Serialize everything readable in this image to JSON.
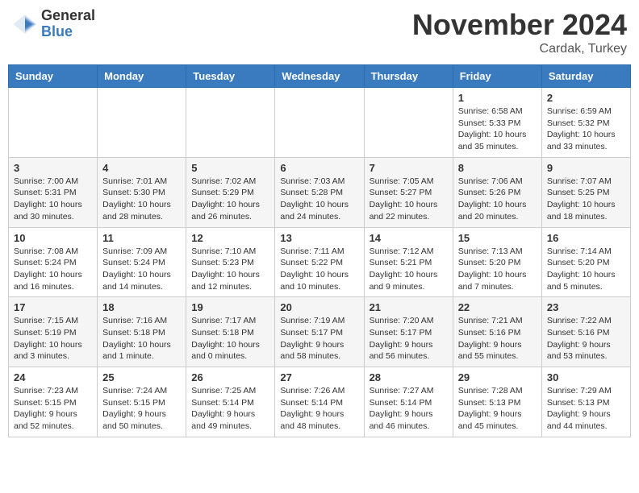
{
  "logo": {
    "general": "General",
    "blue": "Blue"
  },
  "header": {
    "month": "November 2024",
    "location": "Cardak, Turkey"
  },
  "weekdays": [
    "Sunday",
    "Monday",
    "Tuesday",
    "Wednesday",
    "Thursday",
    "Friday",
    "Saturday"
  ],
  "weeks": [
    [
      {
        "day": "",
        "info": ""
      },
      {
        "day": "",
        "info": ""
      },
      {
        "day": "",
        "info": ""
      },
      {
        "day": "",
        "info": ""
      },
      {
        "day": "",
        "info": ""
      },
      {
        "day": "1",
        "info": "Sunrise: 6:58 AM\nSunset: 5:33 PM\nDaylight: 10 hours and 35 minutes."
      },
      {
        "day": "2",
        "info": "Sunrise: 6:59 AM\nSunset: 5:32 PM\nDaylight: 10 hours and 33 minutes."
      }
    ],
    [
      {
        "day": "3",
        "info": "Sunrise: 7:00 AM\nSunset: 5:31 PM\nDaylight: 10 hours and 30 minutes."
      },
      {
        "day": "4",
        "info": "Sunrise: 7:01 AM\nSunset: 5:30 PM\nDaylight: 10 hours and 28 minutes."
      },
      {
        "day": "5",
        "info": "Sunrise: 7:02 AM\nSunset: 5:29 PM\nDaylight: 10 hours and 26 minutes."
      },
      {
        "day": "6",
        "info": "Sunrise: 7:03 AM\nSunset: 5:28 PM\nDaylight: 10 hours and 24 minutes."
      },
      {
        "day": "7",
        "info": "Sunrise: 7:05 AM\nSunset: 5:27 PM\nDaylight: 10 hours and 22 minutes."
      },
      {
        "day": "8",
        "info": "Sunrise: 7:06 AM\nSunset: 5:26 PM\nDaylight: 10 hours and 20 minutes."
      },
      {
        "day": "9",
        "info": "Sunrise: 7:07 AM\nSunset: 5:25 PM\nDaylight: 10 hours and 18 minutes."
      }
    ],
    [
      {
        "day": "10",
        "info": "Sunrise: 7:08 AM\nSunset: 5:24 PM\nDaylight: 10 hours and 16 minutes."
      },
      {
        "day": "11",
        "info": "Sunrise: 7:09 AM\nSunset: 5:24 PM\nDaylight: 10 hours and 14 minutes."
      },
      {
        "day": "12",
        "info": "Sunrise: 7:10 AM\nSunset: 5:23 PM\nDaylight: 10 hours and 12 minutes."
      },
      {
        "day": "13",
        "info": "Sunrise: 7:11 AM\nSunset: 5:22 PM\nDaylight: 10 hours and 10 minutes."
      },
      {
        "day": "14",
        "info": "Sunrise: 7:12 AM\nSunset: 5:21 PM\nDaylight: 10 hours and 9 minutes."
      },
      {
        "day": "15",
        "info": "Sunrise: 7:13 AM\nSunset: 5:20 PM\nDaylight: 10 hours and 7 minutes."
      },
      {
        "day": "16",
        "info": "Sunrise: 7:14 AM\nSunset: 5:20 PM\nDaylight: 10 hours and 5 minutes."
      }
    ],
    [
      {
        "day": "17",
        "info": "Sunrise: 7:15 AM\nSunset: 5:19 PM\nDaylight: 10 hours and 3 minutes."
      },
      {
        "day": "18",
        "info": "Sunrise: 7:16 AM\nSunset: 5:18 PM\nDaylight: 10 hours and 1 minute."
      },
      {
        "day": "19",
        "info": "Sunrise: 7:17 AM\nSunset: 5:18 PM\nDaylight: 10 hours and 0 minutes."
      },
      {
        "day": "20",
        "info": "Sunrise: 7:19 AM\nSunset: 5:17 PM\nDaylight: 9 hours and 58 minutes."
      },
      {
        "day": "21",
        "info": "Sunrise: 7:20 AM\nSunset: 5:17 PM\nDaylight: 9 hours and 56 minutes."
      },
      {
        "day": "22",
        "info": "Sunrise: 7:21 AM\nSunset: 5:16 PM\nDaylight: 9 hours and 55 minutes."
      },
      {
        "day": "23",
        "info": "Sunrise: 7:22 AM\nSunset: 5:16 PM\nDaylight: 9 hours and 53 minutes."
      }
    ],
    [
      {
        "day": "24",
        "info": "Sunrise: 7:23 AM\nSunset: 5:15 PM\nDaylight: 9 hours and 52 minutes."
      },
      {
        "day": "25",
        "info": "Sunrise: 7:24 AM\nSunset: 5:15 PM\nDaylight: 9 hours and 50 minutes."
      },
      {
        "day": "26",
        "info": "Sunrise: 7:25 AM\nSunset: 5:14 PM\nDaylight: 9 hours and 49 minutes."
      },
      {
        "day": "27",
        "info": "Sunrise: 7:26 AM\nSunset: 5:14 PM\nDaylight: 9 hours and 48 minutes."
      },
      {
        "day": "28",
        "info": "Sunrise: 7:27 AM\nSunset: 5:14 PM\nDaylight: 9 hours and 46 minutes."
      },
      {
        "day": "29",
        "info": "Sunrise: 7:28 AM\nSunset: 5:13 PM\nDaylight: 9 hours and 45 minutes."
      },
      {
        "day": "30",
        "info": "Sunrise: 7:29 AM\nSunset: 5:13 PM\nDaylight: 9 hours and 44 minutes."
      }
    ]
  ]
}
